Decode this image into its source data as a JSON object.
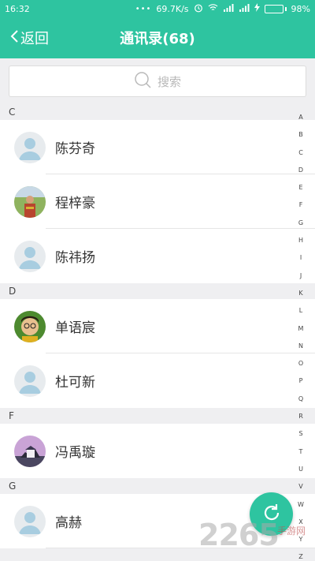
{
  "status": {
    "time": "16:32",
    "speed": "69.7K/s",
    "battery_level": "98%",
    "battery_fraction": 0.98
  },
  "header": {
    "back_label": "返回",
    "title": "通讯录(68)"
  },
  "search": {
    "placeholder": "搜索"
  },
  "sections": [
    {
      "letter": "C",
      "contacts": [
        {
          "name": "陈芬奇",
          "avatar": "default"
        },
        {
          "name": "程梓豪",
          "avatar": "photo-person"
        },
        {
          "name": "陈祎扬",
          "avatar": "default"
        }
      ]
    },
    {
      "letter": "D",
      "contacts": [
        {
          "name": "单语宸",
          "avatar": "photo-boy"
        },
        {
          "name": "杜可新",
          "avatar": "default"
        }
      ]
    },
    {
      "letter": "F",
      "contacts": [
        {
          "name": "冯禹璇",
          "avatar": "photo-castle"
        }
      ]
    },
    {
      "letter": "G",
      "contacts": [
        {
          "name": "高赫",
          "avatar": "default"
        }
      ]
    }
  ],
  "alphabet": [
    "A",
    "B",
    "C",
    "D",
    "E",
    "F",
    "G",
    "H",
    "I",
    "J",
    "K",
    "L",
    "M",
    "N",
    "O",
    "P",
    "Q",
    "R",
    "S",
    "T",
    "U",
    "V",
    "W",
    "X",
    "Y",
    "Z"
  ],
  "watermark": {
    "text": "2265",
    "sub": "手游网"
  },
  "colors": {
    "accent": "#2ec4a0",
    "background": "#efeff1",
    "avatar_default": "#a8cde0"
  }
}
